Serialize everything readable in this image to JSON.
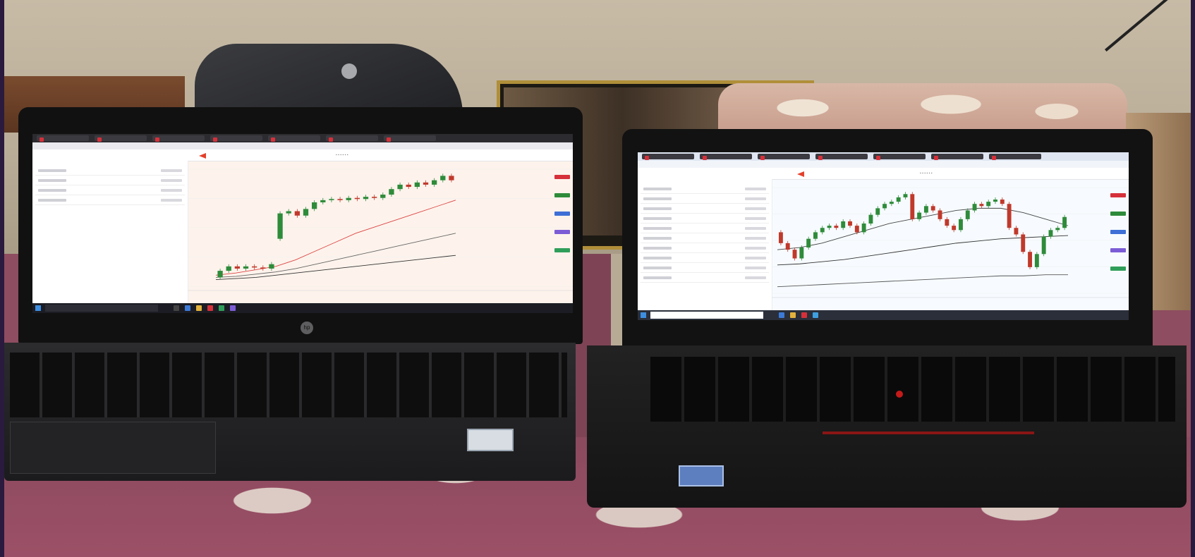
{
  "scene": "two-laptops-trading-charts",
  "laptop_left": {
    "brand_logo": "hp-logo",
    "sticker": "intel core i3",
    "screen": {
      "app": "Kite by Zerodha",
      "tabs": 7,
      "watchlist_rows": 4,
      "chart": {
        "type": "candlestick",
        "trend": "rising",
        "candles": [
          {
            "o": 20,
            "c": 26,
            "up": true
          },
          {
            "o": 26,
            "c": 30,
            "up": true
          },
          {
            "o": 30,
            "c": 28,
            "up": false
          },
          {
            "o": 28,
            "c": 30,
            "up": true
          },
          {
            "o": 30,
            "c": 29,
            "up": false
          },
          {
            "o": 29,
            "c": 28,
            "up": false
          },
          {
            "o": 28,
            "c": 32,
            "up": true
          },
          {
            "o": 55,
            "c": 78,
            "up": true
          },
          {
            "o": 78,
            "c": 80,
            "up": true
          },
          {
            "o": 80,
            "c": 76,
            "up": false
          },
          {
            "o": 76,
            "c": 82,
            "up": true
          },
          {
            "o": 82,
            "c": 88,
            "up": true
          },
          {
            "o": 88,
            "c": 90,
            "up": true
          },
          {
            "o": 90,
            "c": 91,
            "up": true
          },
          {
            "o": 91,
            "c": 90,
            "up": false
          },
          {
            "o": 90,
            "c": 92,
            "up": true
          },
          {
            "o": 92,
            "c": 91,
            "up": false
          },
          {
            "o": 91,
            "c": 93,
            "up": true
          },
          {
            "o": 93,
            "c": 92,
            "up": false
          },
          {
            "o": 92,
            "c": 95,
            "up": true
          },
          {
            "o": 95,
            "c": 100,
            "up": true
          },
          {
            "o": 100,
            "c": 104,
            "up": true
          },
          {
            "o": 104,
            "c": 102,
            "up": false
          },
          {
            "o": 102,
            "c": 106,
            "up": true
          },
          {
            "o": 106,
            "c": 104,
            "up": false
          },
          {
            "o": 104,
            "c": 108,
            "up": true
          },
          {
            "o": 108,
            "c": 112,
            "up": true
          },
          {
            "o": 112,
            "c": 108,
            "up": false
          }
        ],
        "moving_averages": [
          {
            "color": "#d44",
            "points": [
              22,
              24,
              27,
              30,
              36,
              44,
              52,
              60,
              66,
              72,
              78,
              84,
              90
            ]
          },
          {
            "color": "#666",
            "points": [
              20,
              21,
              23,
              25,
              28,
              32,
              36,
              40,
              44,
              48,
              52,
              56,
              60
            ]
          },
          {
            "color": "#333",
            "points": [
              18,
              19,
              20,
              22,
              24,
              26,
              28,
              30,
              32,
              34,
              36,
              38,
              40
            ]
          }
        ]
      }
    }
  },
  "laptop_right": {
    "brand_logo": "thinkpad",
    "sticker": "intel",
    "screen": {
      "app": "Kite by Zerodha",
      "tabs": 7,
      "watchlist_rows": 10,
      "chart": {
        "type": "candlestick",
        "trend": "up-then-down",
        "candles": [
          {
            "o": 60,
            "c": 50,
            "up": false
          },
          {
            "o": 50,
            "c": 44,
            "up": false
          },
          {
            "o": 44,
            "c": 36,
            "up": false
          },
          {
            "o": 36,
            "c": 46,
            "up": true
          },
          {
            "o": 46,
            "c": 54,
            "up": true
          },
          {
            "o": 54,
            "c": 60,
            "up": true
          },
          {
            "o": 60,
            "c": 64,
            "up": true
          },
          {
            "o": 64,
            "c": 66,
            "up": true
          },
          {
            "o": 66,
            "c": 64,
            "up": false
          },
          {
            "o": 64,
            "c": 70,
            "up": true
          },
          {
            "o": 70,
            "c": 66,
            "up": false
          },
          {
            "o": 66,
            "c": 60,
            "up": false
          },
          {
            "o": 60,
            "c": 68,
            "up": true
          },
          {
            "o": 68,
            "c": 76,
            "up": true
          },
          {
            "o": 76,
            "c": 82,
            "up": true
          },
          {
            "o": 82,
            "c": 86,
            "up": true
          },
          {
            "o": 86,
            "c": 88,
            "up": true
          },
          {
            "o": 88,
            "c": 92,
            "up": true
          },
          {
            "o": 92,
            "c": 95,
            "up": true
          },
          {
            "o": 95,
            "c": 72,
            "up": false
          },
          {
            "o": 72,
            "c": 78,
            "up": true
          },
          {
            "o": 78,
            "c": 84,
            "up": true
          },
          {
            "o": 84,
            "c": 80,
            "up": false
          },
          {
            "o": 80,
            "c": 72,
            "up": false
          },
          {
            "o": 72,
            "c": 66,
            "up": false
          },
          {
            "o": 66,
            "c": 62,
            "up": false
          },
          {
            "o": 62,
            "c": 72,
            "up": true
          },
          {
            "o": 72,
            "c": 80,
            "up": true
          },
          {
            "o": 80,
            "c": 86,
            "up": true
          },
          {
            "o": 86,
            "c": 84,
            "up": false
          },
          {
            "o": 84,
            "c": 88,
            "up": true
          },
          {
            "o": 88,
            "c": 90,
            "up": true
          },
          {
            "o": 90,
            "c": 86,
            "up": false
          },
          {
            "o": 86,
            "c": 64,
            "up": false
          },
          {
            "o": 64,
            "c": 58,
            "up": false
          },
          {
            "o": 58,
            "c": 42,
            "up": false
          },
          {
            "o": 42,
            "c": 28,
            "up": false
          },
          {
            "o": 28,
            "c": 40,
            "up": true
          },
          {
            "o": 40,
            "c": 56,
            "up": true
          },
          {
            "o": 56,
            "c": 62,
            "up": true
          },
          {
            "o": 62,
            "c": 64,
            "up": true
          },
          {
            "o": 64,
            "c": 74,
            "up": true
          }
        ],
        "moving_averages": [
          {
            "color": "#444",
            "points": [
              44,
              46,
              50,
              56,
              62,
              68,
              72,
              76,
              80,
              82,
              82,
              78,
              72,
              66
            ]
          },
          {
            "color": "#333",
            "points": [
              30,
              31,
              33,
              35,
              38,
              41,
              44,
              47,
              50,
              52,
              54,
              55,
              56,
              57
            ]
          },
          {
            "color": "#555",
            "points": [
              10,
              11,
              12,
              13,
              14,
              15,
              16,
              17,
              18,
              19,
              20,
              20,
              21,
              21
            ]
          }
        ]
      }
    }
  },
  "colors": {
    "bull": "#2e8b3a",
    "bear": "#c0392b",
    "kite_brand": "#e4412b",
    "frame_border": "#2a1a3e"
  }
}
